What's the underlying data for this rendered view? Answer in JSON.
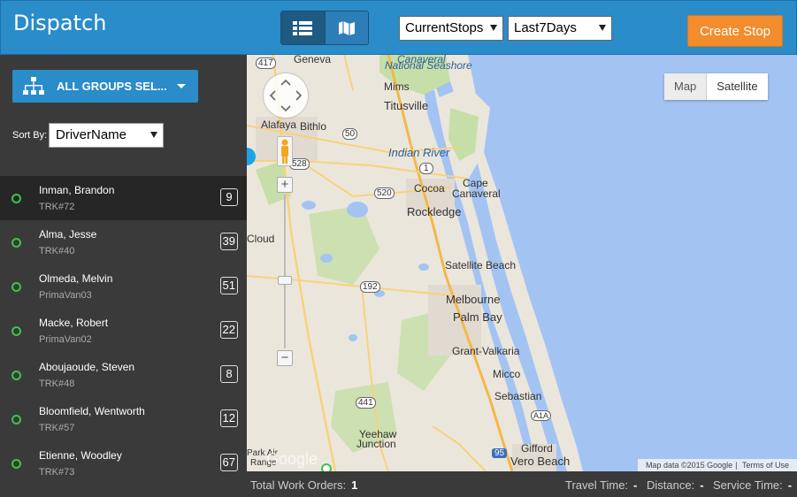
{
  "header": {
    "title": "Dispatch",
    "stops_filter": "CurrentStops",
    "date_filter": "Last7Days",
    "create_label": "Create Stop",
    "brand_color": "#2a8cc9",
    "accent_color": "#f28c2c"
  },
  "sidebar": {
    "groups_label": "ALL GROUPS SEL...",
    "sort_label": "Sort By:",
    "sort_value": "DriverName",
    "drivers": [
      {
        "name": "Inman, Brandon",
        "truck": "TRK#72",
        "count": "9"
      },
      {
        "name": "Alma, Jesse",
        "truck": "TRK#40",
        "count": "39"
      },
      {
        "name": "Olmeda, Melvin",
        "truck": "PrimaVan03",
        "count": "51"
      },
      {
        "name": "Macke, Robert",
        "truck": "PrimaVan02",
        "count": "22"
      },
      {
        "name": "Aboujaoude, Steven",
        "truck": "TRK#48",
        "count": "8"
      },
      {
        "name": "Bloomfield, Wentworth",
        "truck": "TRK#57",
        "count": "12"
      },
      {
        "name": "Etienne, Woodley",
        "truck": "TRK#73",
        "count": "67"
      }
    ]
  },
  "map": {
    "type_map": "Map",
    "type_satellite": "Satellite",
    "credit_data": "Map data ©2015 Google",
    "credit_terms": "Terms of Use",
    "google_label": "Google",
    "places": {
      "geneva": "Geneva",
      "canaveral": "Canaveral",
      "national_seashore": "National Seashore",
      "mims": "Mims",
      "titusville": "Titusville",
      "alafaya": "Alafaya",
      "bithlo": "Bithlo",
      "indian_river": "Indian River",
      "cape": "Cape",
      "cocoa": "Cocoa",
      "cape_canaveral": "Canaveral",
      "rockledge": "Rockledge",
      "cloud": "Cloud",
      "satellite_beach": "Satellite Beach",
      "melbourne": "Melbourne",
      "palm_bay": "Palm Bay",
      "grant_valkaria": "Grant-Valkaria",
      "micco": "Micco",
      "sebastian": "Sebastian",
      "yeehaw": "Yeehaw",
      "junction": "Junction",
      "gifford": "Gifford",
      "vero_beach": "Vero Beach",
      "park_air": "Park Air",
      "range": "Range"
    },
    "shields": {
      "r417": "417",
      "r50": "50",
      "r528": "528",
      "r1": "1",
      "r520": "520",
      "r192": "192",
      "r441": "441",
      "r95": "95",
      "a1a": "A1A"
    }
  },
  "footer": {
    "work_orders_label": "Total Work Orders:",
    "work_orders_value": "1",
    "travel_label": "Travel Time:",
    "travel_value": "-",
    "distance_label": "Distance:",
    "distance_value": "-",
    "service_label": "Service Time:",
    "service_value": "-"
  }
}
